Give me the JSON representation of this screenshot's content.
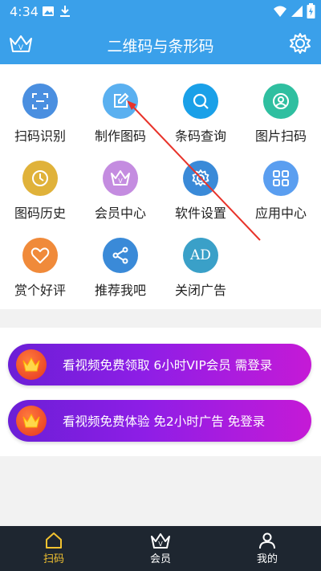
{
  "status_bar": {
    "time": "4:34"
  },
  "header": {
    "title": "二维码与条形码"
  },
  "grid": {
    "items": [
      {
        "label": "扫码识别",
        "icon": "scan-icon",
        "color": "#4a8fe0"
      },
      {
        "label": "制作图码",
        "icon": "edit-icon",
        "color": "#5ab0f0"
      },
      {
        "label": "条码查询",
        "icon": "search-icon",
        "color": "#1aa0e8"
      },
      {
        "label": "图片扫码",
        "icon": "image-icon",
        "color": "#2fbfa0"
      },
      {
        "label": "图码历史",
        "icon": "clock-icon",
        "color": "#e0b23a"
      },
      {
        "label": "会员中心",
        "icon": "crown-icon",
        "color": "#c48ce0"
      },
      {
        "label": "软件设置",
        "icon": "gear-icon",
        "color": "#3a8ad8"
      },
      {
        "label": "应用中心",
        "icon": "apps-icon",
        "color": "#5a9ef0"
      },
      {
        "label": "赏个好评",
        "icon": "heart-icon",
        "color": "#f08a3a"
      },
      {
        "label": "推荐我吧",
        "icon": "share-icon",
        "color": "#3a8ad8"
      },
      {
        "label": "关闭广告",
        "icon": "ad-icon",
        "color": "#3aa0c8",
        "ad_text": "AD"
      }
    ]
  },
  "banners": [
    {
      "text": "看视频免费领取 6小时VIP会员 需登录"
    },
    {
      "text": "看视频免费体验 免2小时广告 免登录"
    }
  ],
  "nav": {
    "items": [
      {
        "label": "扫码",
        "icon": "home-icon",
        "active": true
      },
      {
        "label": "会员",
        "icon": "crown-icon",
        "active": false
      },
      {
        "label": "我的",
        "icon": "user-icon",
        "active": false
      }
    ],
    "active_color": "#f2c230"
  }
}
